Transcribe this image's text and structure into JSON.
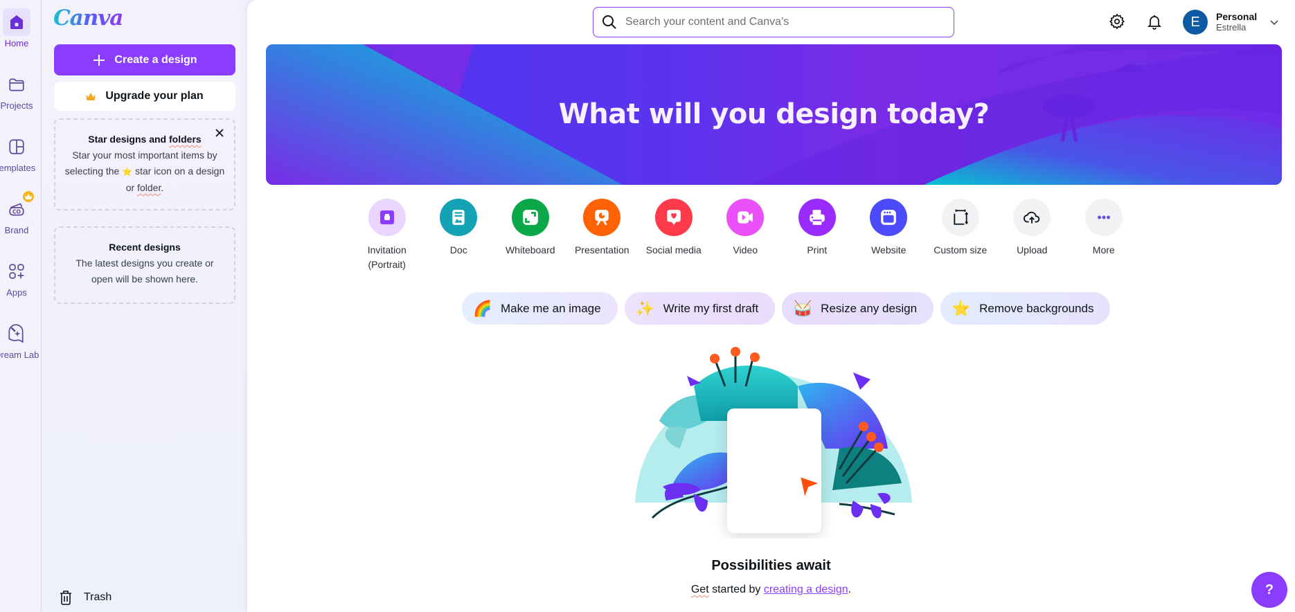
{
  "rail": {
    "items": [
      {
        "label": "Home",
        "icon": "home-icon",
        "active": true
      },
      {
        "label": "Projects",
        "icon": "folder-icon"
      },
      {
        "label": "Templates",
        "icon": "templates-icon"
      },
      {
        "label": "Brand",
        "icon": "brand-icon",
        "badge": "crown-icon"
      },
      {
        "label": "Apps",
        "icon": "apps-icon"
      },
      {
        "label": "Dream Lab",
        "icon": "dream-lab-icon"
      }
    ]
  },
  "panel": {
    "logo": "Canva",
    "create_label": "Create a design",
    "upgrade_label": "Upgrade your plan",
    "star_card": {
      "title_pre": "Star designs and ",
      "title_squiggle": "folders",
      "body_line1": "Star your most important items by selecting the",
      "body_star": "⭐",
      "body_line2": "star icon on a design or",
      "body_squiggle": "folder",
      "body_end": "."
    },
    "recent_card": {
      "title": "Recent designs",
      "body": "The latest designs you create or open will be shown here."
    },
    "trash_label": "Trash"
  },
  "header": {
    "search_placeholder": "Search your content and Canva’s",
    "account_name": "Personal",
    "account_user": "Estrella",
    "avatar_initial": "E"
  },
  "hero": {
    "title": "What will you design today?"
  },
  "shortcuts": [
    {
      "label": "Invitation (Portrait)",
      "icon": "invitation-icon",
      "color": "#e9d5ff"
    },
    {
      "label": "Doc",
      "icon": "doc-icon",
      "color": "#13a3b5"
    },
    {
      "label": "Whiteboard",
      "icon": "whiteboard-icon",
      "color": "#0ba84a"
    },
    {
      "label": "Presentation",
      "icon": "presentation-icon",
      "color": "#ff6105"
    },
    {
      "label": "Social media",
      "icon": "social-media-icon",
      "color": "#ff3b4b"
    },
    {
      "label": "Video",
      "icon": "video-icon",
      "color": "#e950f7"
    },
    {
      "label": "Print",
      "icon": "print-icon",
      "color": "#992bff"
    },
    {
      "label": "Website",
      "icon": "website-icon",
      "color": "#4c4bfc"
    },
    {
      "label": "Custom size",
      "icon": "custom-size-icon",
      "color": "#f1f2f4"
    },
    {
      "label": "Upload",
      "icon": "upload-icon",
      "color": "#f1f2f4"
    },
    {
      "label": "More",
      "icon": "more-icon",
      "color": "#f1f2f4"
    }
  ],
  "pills": [
    {
      "label": "Make me an image",
      "emoji": "🌈"
    },
    {
      "label": "Write my first draft",
      "emoji": "✨"
    },
    {
      "label": "Resize any design",
      "emoji": "🥁"
    },
    {
      "label": "Remove backgrounds",
      "emoji": "⭐"
    }
  ],
  "empty_state": {
    "title": "Possibilities await",
    "sub_pre_squiggle": "Get",
    "sub_pre": " started by ",
    "sub_link": "creating a design",
    "sub_end": "."
  },
  "help_label": "?"
}
